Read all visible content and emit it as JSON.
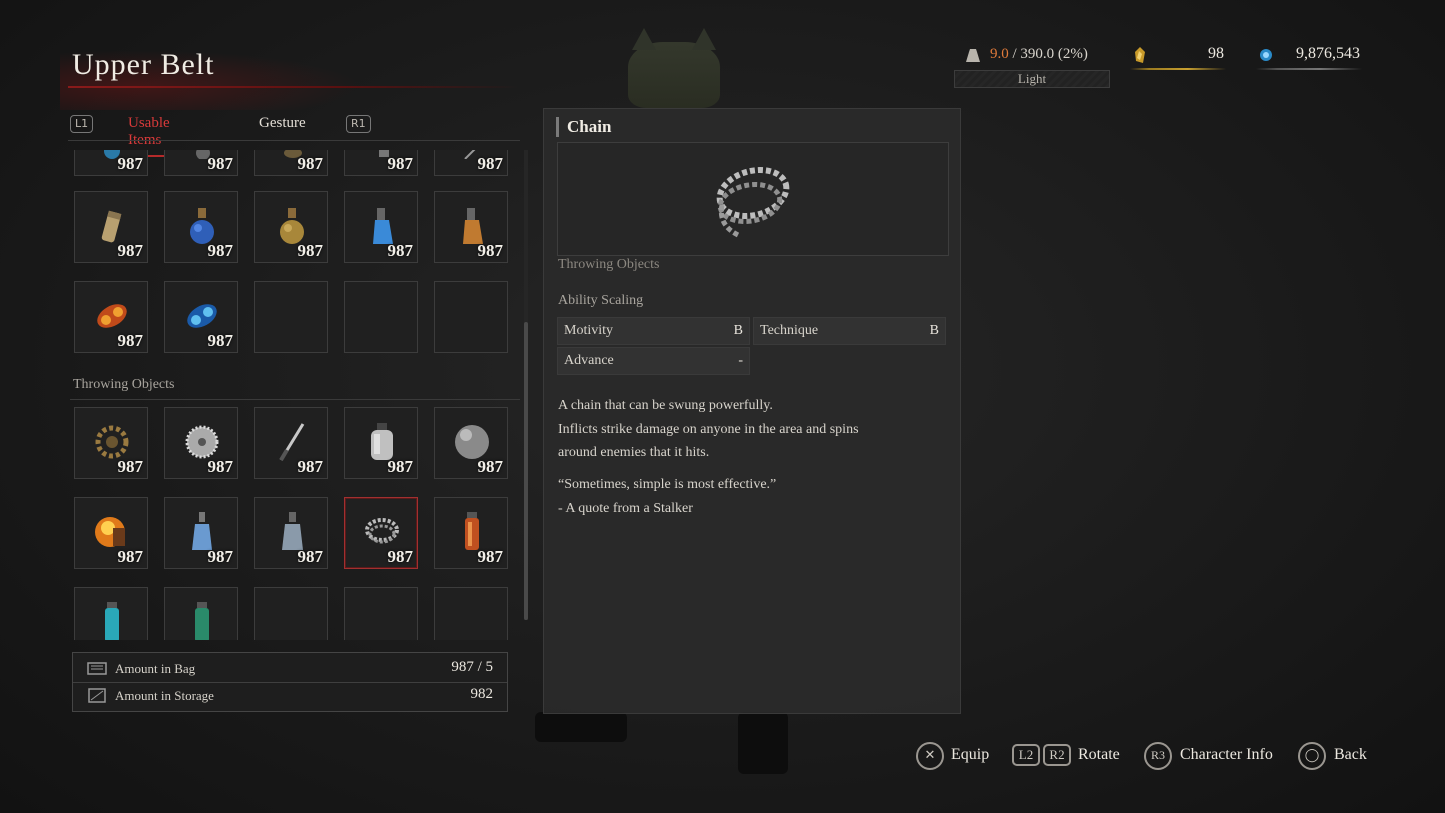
{
  "header": {
    "title": "Upper Belt",
    "tabs": {
      "left_button": "L1",
      "right_button": "R1",
      "items": [
        {
          "label": "Usable Items",
          "active": true
        },
        {
          "label": "Gesture",
          "active": false
        }
      ]
    }
  },
  "grid": {
    "partial_row": [
      {
        "icon": "blue-orb-icon",
        "count": "987"
      },
      {
        "icon": "grinder-icon",
        "count": "987"
      },
      {
        "icon": "pouch-icon",
        "count": "987"
      },
      {
        "icon": "canister-icon",
        "count": "987"
      },
      {
        "icon": "rod-icon",
        "count": "987"
      }
    ],
    "row_1": [
      {
        "icon": "gold-cartridge-icon",
        "count": "987"
      },
      {
        "icon": "blue-flask-icon",
        "count": "987"
      },
      {
        "icon": "amber-flask-icon",
        "count": "987"
      },
      {
        "icon": "blue-vial-icon",
        "count": "987"
      },
      {
        "icon": "orange-vial-icon",
        "count": "987"
      }
    ],
    "row_2": [
      {
        "icon": "fire-cartridge-icon",
        "count": "987"
      },
      {
        "icon": "electric-cartridge-icon",
        "count": "987"
      },
      {
        "icon": "",
        "count": ""
      },
      {
        "icon": "",
        "count": ""
      },
      {
        "icon": "",
        "count": ""
      }
    ],
    "section_label": "Throwing Objects",
    "throw_row_1": [
      {
        "icon": "gear-icon",
        "count": "987"
      },
      {
        "icon": "saw-blade-icon",
        "count": "987"
      },
      {
        "icon": "throwing-knife-icon",
        "count": "987"
      },
      {
        "icon": "jar-icon",
        "count": "987"
      },
      {
        "icon": "iron-ball-icon",
        "count": "987"
      }
    ],
    "throw_row_2": [
      {
        "icon": "fire-bomb-icon",
        "count": "987"
      },
      {
        "icon": "blue-bottle-icon",
        "count": "987"
      },
      {
        "icon": "grey-bottle-icon",
        "count": "987"
      },
      {
        "icon": "chain-icon",
        "count": "987"
      },
      {
        "icon": "red-canister-icon",
        "count": "987"
      }
    ],
    "throw_row_3": [
      {
        "icon": "cyan-canister-icon",
        "count": ""
      },
      {
        "icon": "green-canister-icon",
        "count": ""
      },
      {
        "icon": "",
        "count": ""
      },
      {
        "icon": "",
        "count": ""
      },
      {
        "icon": "",
        "count": ""
      }
    ]
  },
  "amounts": {
    "bag_label": "Amount in Bag",
    "bag_value": "987 / 5",
    "storage_label": "Amount in Storage",
    "storage_value": "982"
  },
  "detail": {
    "name": "Chain",
    "image_icon": "chain-icon",
    "category": "Throwing Objects",
    "scaling_label": "Ability Scaling",
    "stats": [
      {
        "name": "Motivity",
        "value": "B"
      },
      {
        "name": "Technique",
        "value": "B"
      },
      {
        "name": "Advance",
        "value": "-"
      }
    ],
    "description_lines": [
      "A chain that can be swung powerfully.",
      "Inflicts strike damage on anyone in the area and spins",
      "around enemies that it hits."
    ],
    "quote_lines": [
      "“Sometimes, simple is most effective.”",
      "- A quote from a Stalker"
    ]
  },
  "status": {
    "weight_current": "9.0",
    "weight_rest": " / 390.0 (2%)",
    "weight_class": "Light",
    "gold_coin_value": "98",
    "ergo_value": "9,876,543",
    "colors": {
      "weight_current": "#e07a3a",
      "accent_red": "#b52a2a",
      "gold_line": "#9a7a20"
    }
  },
  "footer": {
    "prompts": [
      {
        "button": "✕",
        "label": "Equip"
      },
      {
        "button": "L2",
        "button2": "R2",
        "label": "Rotate"
      },
      {
        "button": "R3",
        "label": "Character Info"
      },
      {
        "button": "◯",
        "label": "Back"
      }
    ]
  }
}
